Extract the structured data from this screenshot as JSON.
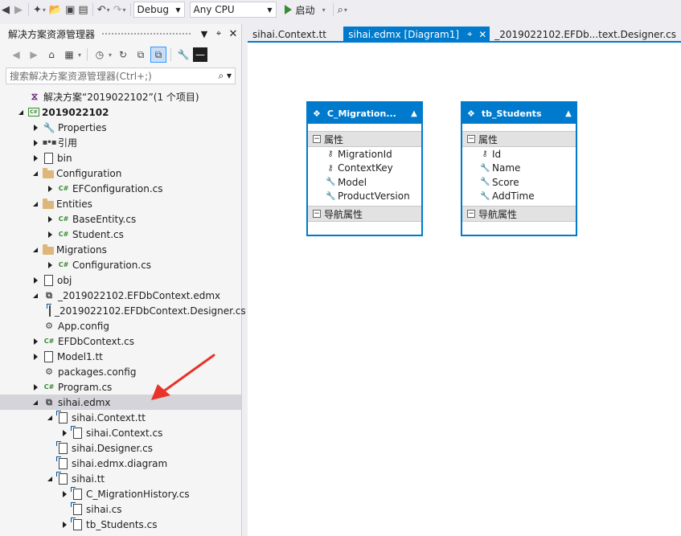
{
  "toolbar": {
    "config": "Debug",
    "platform": "Any CPU",
    "start_label": "启动"
  },
  "explorer": {
    "title": "解决方案资源管理器",
    "search_placeholder": "搜索解决方案资源管理器(Ctrl+;)",
    "tree": [
      {
        "label": "解决方案“2019022102”(1 个项目)",
        "icon": "solution-icon",
        "level": 0,
        "twisty": "none"
      },
      {
        "label": "2019022102",
        "icon": "csharp-project-icon",
        "level": 0,
        "twisty": "expanded",
        "bold": true
      },
      {
        "label": "Properties",
        "icon": "wrench-icon",
        "level": 1,
        "twisty": "collapsed"
      },
      {
        "label": "引用",
        "icon": "reference-icon",
        "level": 1,
        "twisty": "collapsed"
      },
      {
        "label": "bin",
        "icon": "page-icon",
        "level": 1,
        "twisty": "collapsed"
      },
      {
        "label": "Configuration",
        "icon": "folder-icon",
        "level": 1,
        "twisty": "expanded"
      },
      {
        "label": "EFConfiguration.cs",
        "icon": "csharp-file-icon",
        "level": 2,
        "twisty": "collapsed"
      },
      {
        "label": "Entities",
        "icon": "folder-icon",
        "level": 1,
        "twisty": "expanded"
      },
      {
        "label": "BaseEntity.cs",
        "icon": "csharp-file-icon",
        "level": 2,
        "twisty": "collapsed"
      },
      {
        "label": "Student.cs",
        "icon": "csharp-file-icon",
        "level": 2,
        "twisty": "collapsed"
      },
      {
        "label": "Migrations",
        "icon": "folder-icon",
        "level": 1,
        "twisty": "expanded"
      },
      {
        "label": "Configuration.cs",
        "icon": "csharp-file-icon",
        "level": 2,
        "twisty": "collapsed"
      },
      {
        "label": "obj",
        "icon": "page-icon",
        "level": 1,
        "twisty": "collapsed"
      },
      {
        "label": "_2019022102.EFDbContext.edmx",
        "icon": "edmx-icon",
        "level": 1,
        "twisty": "expanded"
      },
      {
        "label": "_2019022102.EFDbContext.Designer.cs",
        "icon": "template-file-icon",
        "level": 2,
        "twisty": "none"
      },
      {
        "label": "App.config",
        "icon": "config-icon",
        "level": 1,
        "twisty": "none"
      },
      {
        "label": "EFDbContext.cs",
        "icon": "csharp-file-icon",
        "level": 1,
        "twisty": "collapsed"
      },
      {
        "label": "Model1.tt",
        "icon": "page-icon",
        "level": 1,
        "twisty": "collapsed"
      },
      {
        "label": "packages.config",
        "icon": "config-icon",
        "level": 1,
        "twisty": "none"
      },
      {
        "label": "Program.cs",
        "icon": "csharp-file-icon",
        "level": 1,
        "twisty": "collapsed"
      },
      {
        "label": "sihai.edmx",
        "icon": "edmx-icon",
        "level": 1,
        "twisty": "expanded",
        "selected": true
      },
      {
        "label": "sihai.Context.tt",
        "icon": "template-file-icon",
        "level": 2,
        "twisty": "expanded"
      },
      {
        "label": "sihai.Context.cs",
        "icon": "template-file-icon",
        "level": 3,
        "twisty": "collapsed"
      },
      {
        "label": "sihai.Designer.cs",
        "icon": "template-file-icon",
        "level": 2,
        "twisty": "none"
      },
      {
        "label": "sihai.edmx.diagram",
        "icon": "template-file-icon",
        "level": 2,
        "twisty": "none"
      },
      {
        "label": "sihai.tt",
        "icon": "template-file-icon",
        "level": 2,
        "twisty": "expanded"
      },
      {
        "label": "C_MigrationHistory.cs",
        "icon": "template-file-icon",
        "level": 3,
        "twisty": "collapsed"
      },
      {
        "label": "sihai.cs",
        "icon": "template-file-icon",
        "level": 3,
        "twisty": "none"
      },
      {
        "label": "tb_Students.cs",
        "icon": "template-file-icon",
        "level": 3,
        "twisty": "collapsed"
      }
    ]
  },
  "tabs": [
    {
      "label": "sihai.Context.tt",
      "active": false
    },
    {
      "label": "sihai.edmx [Diagram1]",
      "active": true
    },
    {
      "label": "_2019022102.EFDb...text.Designer.cs",
      "active": false
    }
  ],
  "entities": [
    {
      "title": "C_Migration...",
      "props_label": "属性",
      "nav_label": "导航属性",
      "properties": [
        {
          "name": "MigrationId",
          "key": true
        },
        {
          "name": "ContextKey",
          "key": true
        },
        {
          "name": "Model",
          "key": false
        },
        {
          "name": "ProductVersion",
          "key": false
        }
      ]
    },
    {
      "title": "tb_Students",
      "props_label": "属性",
      "nav_label": "导航属性",
      "properties": [
        {
          "name": "Id",
          "key": true
        },
        {
          "name": "Name",
          "key": false
        },
        {
          "name": "Score",
          "key": false
        },
        {
          "name": "AddTime",
          "key": false
        }
      ]
    }
  ],
  "colors": {
    "accent": "#007acc",
    "selection": "#d4d4da",
    "annotation_arrow": "#e8332a"
  }
}
